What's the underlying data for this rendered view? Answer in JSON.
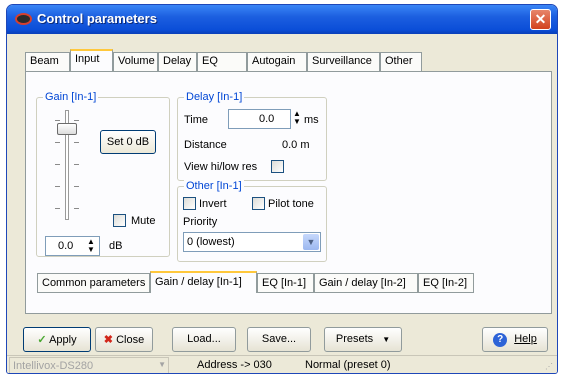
{
  "window": {
    "title": "Control parameters"
  },
  "tabs": [
    "Beam",
    "Input",
    "Volume",
    "Delay",
    "EQ",
    "Autogain",
    "Surveillance",
    "Other"
  ],
  "gain_group": {
    "title": "Gain [In-1]",
    "set_button": "Set 0 dB",
    "mute_label": "Mute",
    "value": "0.0",
    "unit": "dB"
  },
  "delay_group": {
    "title": "Delay [In-1]",
    "time_label": "Time",
    "time_value": "0.0",
    "time_unit": "ms",
    "distance_label": "Distance",
    "distance_value": "0.0 m",
    "view_label": "View hi/low res"
  },
  "other_group": {
    "title": "Other [In-1]",
    "invert_label": "Invert",
    "pilot_label": "Pilot tone",
    "priority_label": "Priority",
    "priority_value": "0 (lowest)"
  },
  "subtabs": [
    "Common parameters",
    "Gain / delay [In-1]",
    "EQ [In-1]",
    "Gain / delay [In-2]",
    "EQ [In-2]"
  ],
  "buttons": {
    "apply": "Apply",
    "close": "Close",
    "load": "Load...",
    "save": "Save...",
    "presets": "Presets",
    "help": "Help"
  },
  "status": {
    "device": "Intellivox-DS280",
    "address": "Address -> 030",
    "mode": "Normal (preset 0)"
  },
  "colors": {
    "title_bar": "#0b4ed8",
    "group_title": "#0046d5",
    "tab_highlight": "#ffc83c"
  }
}
